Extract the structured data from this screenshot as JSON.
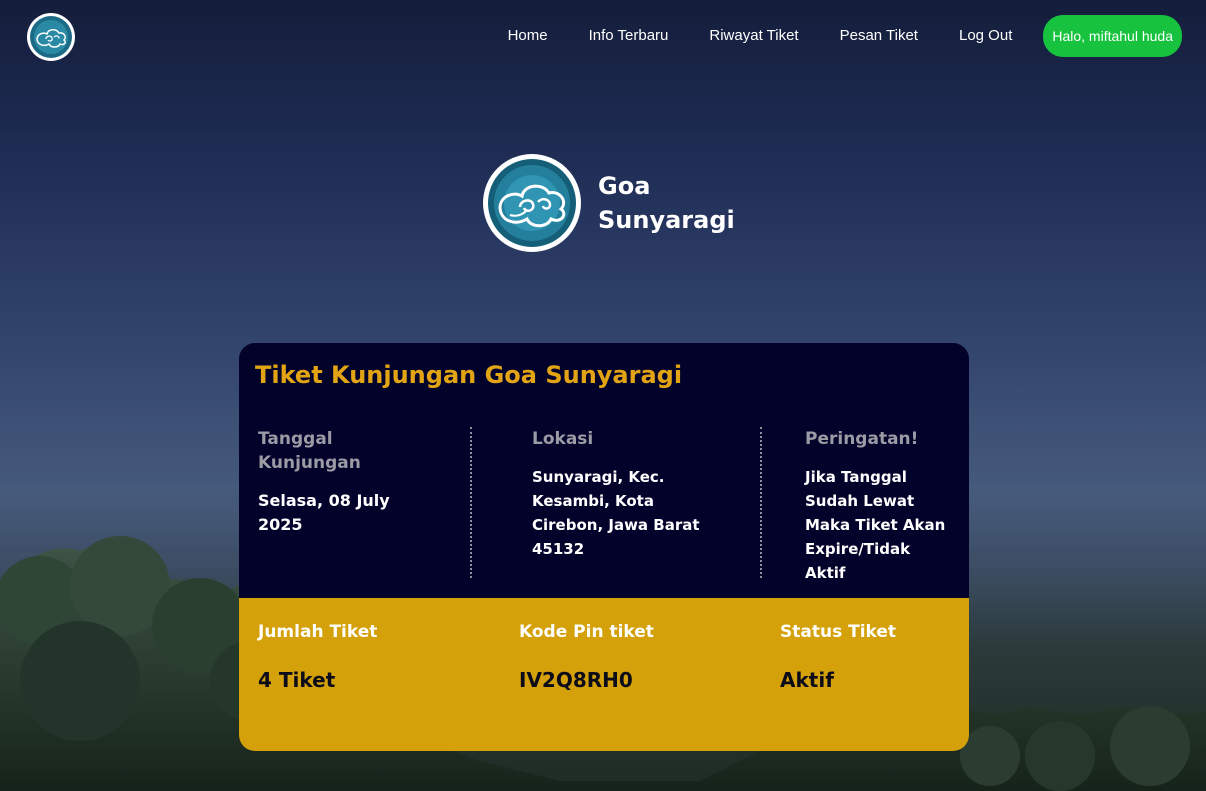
{
  "nav": {
    "links": [
      {
        "label": "Home"
      },
      {
        "label": "Info Terbaru"
      },
      {
        "label": "Riwayat Tiket"
      },
      {
        "label": "Pesan Tiket"
      },
      {
        "label": "Log Out"
      }
    ],
    "greeting": "Halo, miftahul huda",
    "greeting_color": "#16c23e",
    "logo_icon": "batik-cloud-logo-icon"
  },
  "brand": {
    "name": "Goa Sunyaragi",
    "logo_icon": "batik-cloud-logo-icon"
  },
  "ticket": {
    "title": "Tiket Kunjungan Goa Sunyaragi",
    "title_color": "#e2a412",
    "background_color": "#03022b",
    "info": {
      "date_label": "Tanggal Kunjungan",
      "date_value": "Selasa, 08 July 2025",
      "location_label": "Lokasi",
      "location_value": "Sunyaragi, Kec. Kesambi, Kota Cirebon, Jawa Barat 45132",
      "warning_label": "Peringatan!",
      "warning_value": "Jika Tanggal Sudah Lewat Maka Tiket Akan Expire/Tidak Aktif"
    },
    "summary": {
      "background_color": "#d4a10b",
      "count_label": "Jumlah Tiket",
      "count_value": "4 Tiket",
      "pin_label": "Kode Pin tiket",
      "pin_value": "IV2Q8RH0",
      "status_label": "Status Tiket",
      "status_value": "Aktif"
    }
  }
}
